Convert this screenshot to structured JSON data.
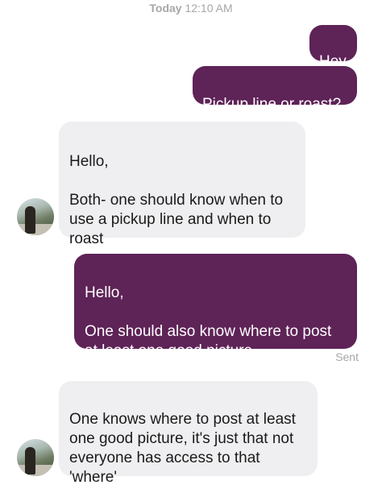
{
  "header": {
    "day": "Today",
    "time": "12:10 AM"
  },
  "messages": [
    {
      "direction": "outgoing",
      "text": "Hey"
    },
    {
      "direction": "outgoing",
      "text": "Pickup line or roast?"
    },
    {
      "direction": "incoming",
      "text": "Hello,\n\nBoth- one should know when to use a pickup line and when to roast"
    },
    {
      "direction": "outgoing",
      "text": "Hello,\n\nOne should also know where to post at least one good picture."
    },
    {
      "direction": "incoming",
      "text": "One knows where to post at least one good picture, it's just that not everyone has access to that 'where'"
    }
  ],
  "status": {
    "sent_label": "Sent"
  },
  "colors": {
    "outgoing_bubble": "#5e2357",
    "incoming_bubble": "#efeff1",
    "meta_text": "#a7a7ab"
  }
}
